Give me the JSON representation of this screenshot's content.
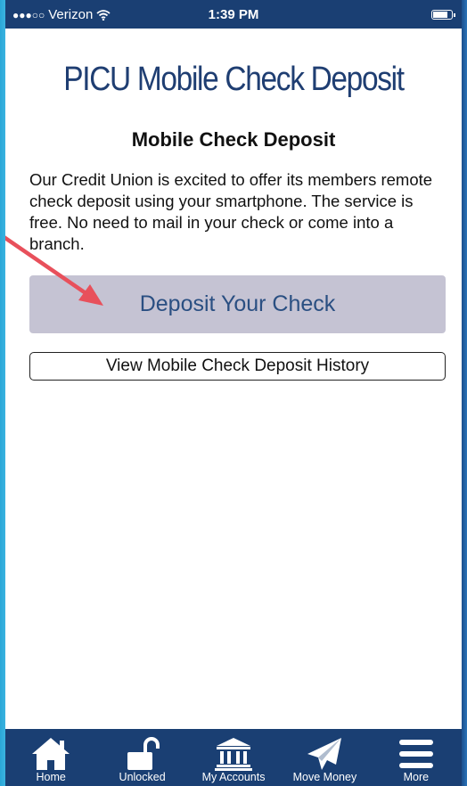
{
  "status_bar": {
    "signal_dots": "●●●○○",
    "carrier": "Verizon",
    "wifi_icon": "wifi-icon",
    "time": "1:39 PM",
    "battery_icon": "battery-icon"
  },
  "header": {
    "brand_title": "PICU Mobile Check Deposit"
  },
  "content": {
    "section_title": "Mobile Check Deposit",
    "intro_text": "Our Credit Union is excited to offer its members remote check deposit using your smartphone. The service is free. No need to mail in your check or come into a branch.",
    "deposit_button_label": "Deposit Your Check",
    "history_button_label": "View Mobile Check Deposit History"
  },
  "tabs": [
    {
      "label": "Home",
      "icon": "home-icon"
    },
    {
      "label": "Unlocked",
      "icon": "unlocked-padlock-icon"
    },
    {
      "label": "My Accounts",
      "icon": "bank-icon"
    },
    {
      "label": "Move Money",
      "icon": "paper-plane-icon"
    },
    {
      "label": "More",
      "icon": "hamburger-menu-icon"
    }
  ],
  "colors": {
    "bar_navy": "#1a3f73",
    "brand_text": "#1f3e72",
    "deposit_button_bg": "#c5c3d3",
    "deposit_button_text": "#2a4f82",
    "annotation_arrow": "#e8505b"
  }
}
